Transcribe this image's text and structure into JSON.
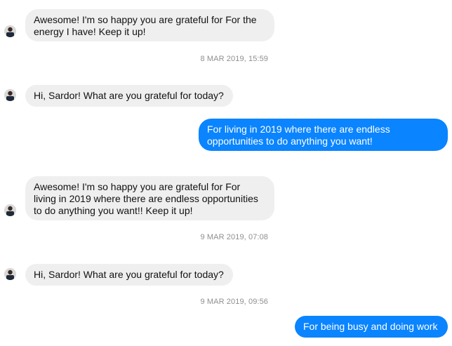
{
  "messages": [
    {
      "direction": "incoming",
      "text": "Awesome! I'm so happy you are grateful for For the\nenergy I have! Keep it up!"
    },
    {
      "timestamp": "8 MAR 2019, 15:59"
    },
    {
      "direction": "incoming",
      "text": "Hi, Sardor! What are you grateful for today?"
    },
    {
      "direction": "outgoing",
      "text": "For living in 2019 where there are endless\nopportunities to do anything  you want!"
    },
    {
      "direction": "incoming",
      "text": "Awesome! I'm so happy you are grateful for For\nliving in 2019 where there are endless opportunities\nto do anything  you want!! Keep it up!"
    },
    {
      "timestamp": "9 MAR 2019, 07:08"
    },
    {
      "direction": "incoming",
      "text": "Hi, Sardor! What are you grateful for today?"
    },
    {
      "timestamp": "9 MAR 2019, 09:56"
    },
    {
      "direction": "outgoing",
      "text": "For being busy and doing work"
    }
  ],
  "colors": {
    "incoming_bubble": "#efefef",
    "outgoing_bubble": "#0a84ff",
    "timestamp_text": "#8f8f8f"
  },
  "avatar_icon": "person-avatar-icon"
}
